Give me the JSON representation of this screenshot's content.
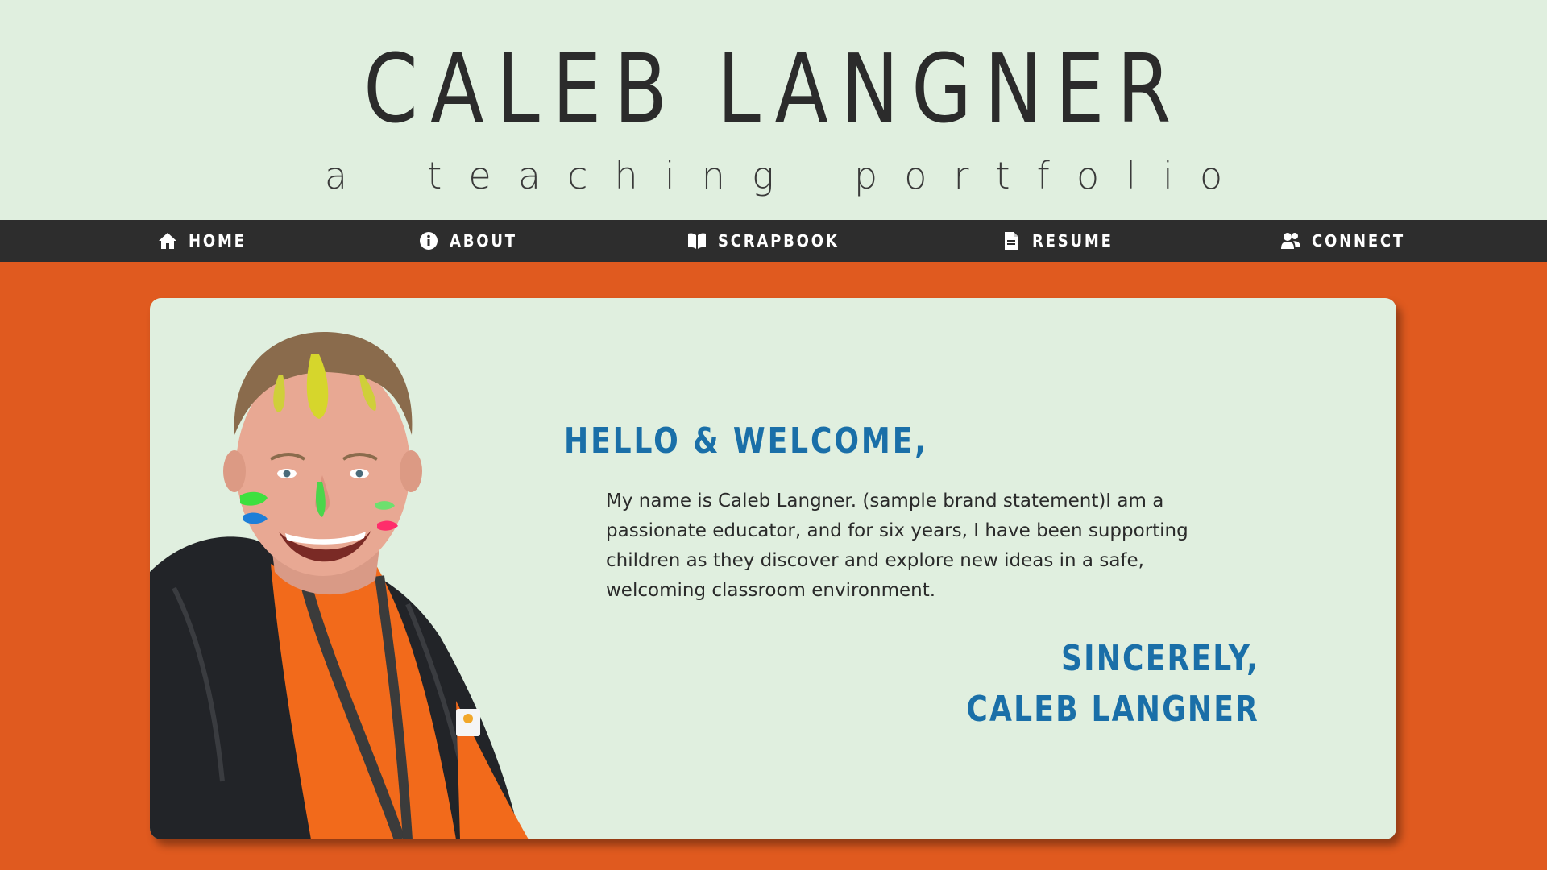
{
  "header": {
    "title": "CALEB LANGNER",
    "subtitle": "a teaching portfolio"
  },
  "nav": {
    "items": [
      {
        "label": "HOME",
        "icon": "home-icon"
      },
      {
        "label": "ABOUT",
        "icon": "info-icon"
      },
      {
        "label": "SCRAPBOOK",
        "icon": "book-icon"
      },
      {
        "label": "RESUME",
        "icon": "document-icon"
      },
      {
        "label": "CONNECT",
        "icon": "users-icon"
      }
    ]
  },
  "welcome": {
    "greeting": "HELLO & WELCOME,",
    "statement": "My name is Caleb Langner. (sample brand statement)I am a passionate educator, and for six years, I have been supporting children as they discover and explore new ideas in a safe, welcoming classroom environment.",
    "signoff_line1": "SINCERELY,",
    "signoff_line2": "CALEB LANGNER"
  },
  "colors": {
    "header_bg": "#e0efdf",
    "nav_bg": "#2d2d2d",
    "page_bg": "#e05a1f",
    "accent_blue": "#1a6fa8"
  }
}
